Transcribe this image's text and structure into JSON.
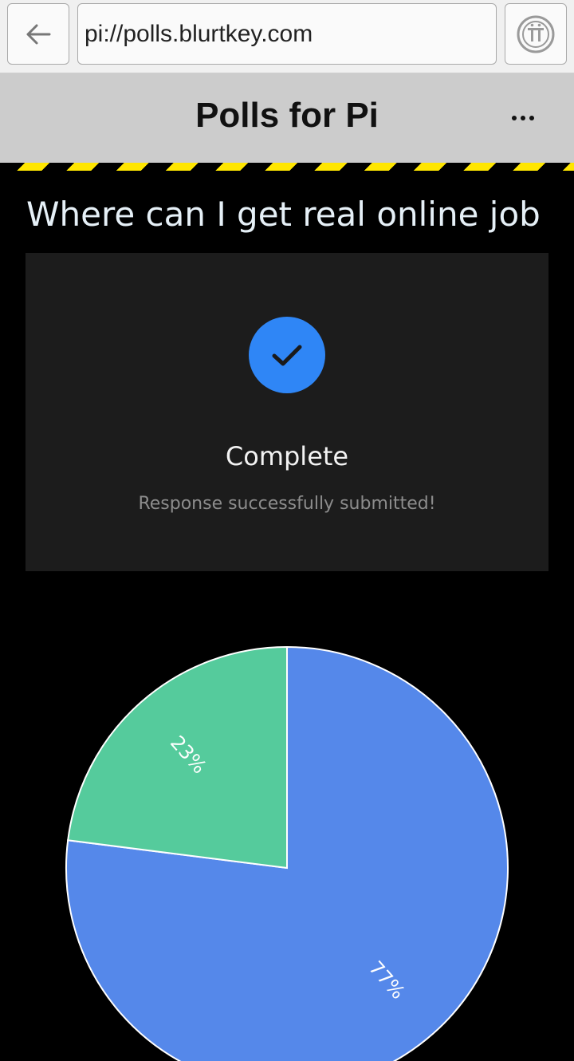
{
  "browser": {
    "url": "pi://polls.blurtkey.com",
    "back_icon": "arrow-left-icon",
    "pi_icon": "pi-logo-icon"
  },
  "header": {
    "title": "Polls for Pi",
    "menu_icon": "more-dots-icon"
  },
  "poll": {
    "question": "Where can I get real online job",
    "status": {
      "title": "Complete",
      "message": "Response successfully submitted!",
      "icon": "checkmark-icon"
    }
  },
  "colors": {
    "header_bg": "#cccccc",
    "accent": "#2f86f6",
    "card_bg": "#1c1c1c",
    "hazard_yellow": "#ffe600"
  },
  "chart_data": {
    "type": "pie",
    "slices": [
      {
        "value": 77,
        "label": "77%",
        "color": "#5588ea"
      },
      {
        "value": 23,
        "label": "23%",
        "color": "#55cb9c"
      }
    ]
  }
}
